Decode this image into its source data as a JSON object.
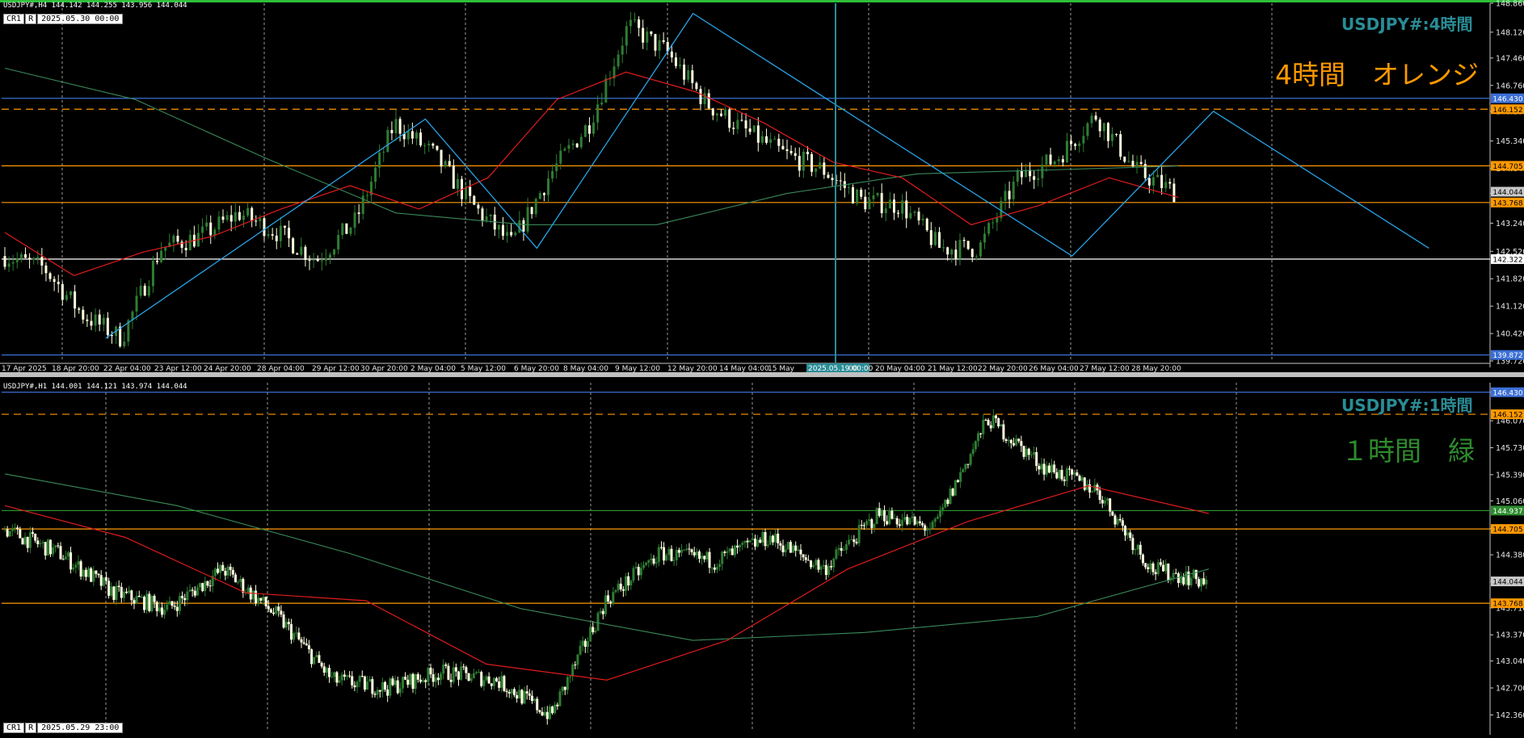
{
  "colors": {
    "orange": "#ff9900",
    "green": "#2e8b2e",
    "teal": "#2a8c96",
    "bull": "#2e7d32",
    "bear": "#ffffe0",
    "ma_red": "#e01c1c",
    "ma_green": "#3a8a5a",
    "zz_blue": "#29a3e6",
    "zz_yellow": "#f2c200",
    "blue_line": "#3b6fd6"
  },
  "panes": [
    {
      "header": "USDJPY#,H4  144.142 144.255 143.956 144.044",
      "cr": "CR1",
      "r": "R",
      "date_box": "2025.05.30 00:00",
      "title": "USDJPY#:4時間",
      "note": "4時間　オレンジ",
      "price_ticks": [
        "148.860",
        "148.120",
        "147.460",
        "146.760",
        "146.100",
        "145.340",
        "144.640",
        "144.000",
        "143.240",
        "142.520",
        "141.820",
        "141.120",
        "140.420",
        "139.720"
      ],
      "time_labels": [
        "17 Apr 2025",
        "18 Apr 20:00",
        "22 Apr 04:00",
        "23 Apr 12:00",
        "24 Apr 20:00",
        "28 Apr 04:00",
        "29 Apr 12:00",
        "30 Apr 20:00",
        "2 May 04:00",
        "5 May 12:00",
        "6 May 20:00",
        "8 May 04:00",
        "9 May 12:00",
        "12 May 20:00",
        "14 May 04:00",
        "15 May",
        "2025.05.19 00:00",
        "00",
        "20 May 04:00",
        "21 May 12:00",
        "22 May 20:00",
        "26 May 04:00",
        "27 May 12:00",
        "28 May 20:00"
      ],
      "levels": [
        {
          "price": 146.43,
          "label": "146.430",
          "style": "solid",
          "color": "#3b6fd6",
          "tag": "#3b6fd6"
        },
        {
          "price": 146.152,
          "label": "146.152",
          "style": "dashed",
          "color": "#ff9900",
          "tag": "#ff9900"
        },
        {
          "price": 144.705,
          "label": "144.705",
          "style": "solid",
          "color": "#ff9900",
          "tag": "#ff9900"
        },
        {
          "price": 143.768,
          "label": "143.768",
          "style": "solid",
          "color": "#ff9900",
          "tag": "#ff9900"
        },
        {
          "price": 142.322,
          "label": "142.322",
          "style": "solid",
          "color": "#ffffff",
          "tag": "#ffffff"
        },
        {
          "price": 139.872,
          "label": "139.872",
          "style": "solid",
          "color": "#3b6fd6",
          "tag": "#3b6fd6"
        }
      ],
      "current_price": "144.044"
    },
    {
      "header": "USDJPY#,H1  144.001 144.121 143.974 144.044",
      "cr": "CR1",
      "r": "R",
      "date_box": "2025.05.29 23:00",
      "title": "USDJPY#:1時間",
      "note": "１時間　緑",
      "price_ticks": [
        "146.430",
        "146.070",
        "145.730",
        "145.390",
        "145.060",
        "144.710",
        "144.380",
        "144.044",
        "143.710",
        "143.370",
        "143.040",
        "142.700",
        "142.360"
      ],
      "levels": [
        {
          "price": 146.43,
          "label": "146.430",
          "style": "solid",
          "color": "#3b6fd6",
          "tag": "#3b6fd6"
        },
        {
          "price": 146.152,
          "label": "146.152",
          "style": "dashed",
          "color": "#ff9900",
          "tag": "#ff9900"
        },
        {
          "price": 144.937,
          "label": "144.937",
          "style": "solid",
          "color": "#2e8b2e",
          "tag": "#2e8b2e"
        },
        {
          "price": 144.705,
          "label": "144.705",
          "style": "solid",
          "color": "#ff9900",
          "tag": "#ff9900"
        },
        {
          "price": 143.768,
          "label": "143.768",
          "style": "solid",
          "color": "#ff9900",
          "tag": "#ff9900"
        }
      ],
      "current_price": "144.044"
    }
  ],
  "chart_data": [
    {
      "type": "candlestick",
      "timeframe": "H4",
      "ylim": [
        139.72,
        148.86
      ],
      "x_range": [
        "17 Apr 2025",
        "3 Jun 2025"
      ],
      "close_path": [
        [
          "17 Apr 2025",
          142.4
        ],
        [
          "18 Apr 20:00",
          142.1
        ],
        [
          "21 Apr",
          140.9
        ],
        [
          "22 Apr 04:00",
          140.3
        ],
        [
          "23 Apr 12:00",
          142.6
        ],
        [
          "24 Apr 20:00",
          142.9
        ],
        [
          "25 Apr",
          143.5
        ],
        [
          "28 Apr 04:00",
          143.0
        ],
        [
          "29 Apr 12:00",
          142.3
        ],
        [
          "30 Apr 20:00",
          143.3
        ],
        [
          "1 May",
          145.8
        ],
        [
          "2 May 04:00",
          145.0
        ],
        [
          "5 May 12:00",
          143.7
        ],
        [
          "6 May 20:00",
          142.7
        ],
        [
          "8 May 04:00",
          144.5
        ],
        [
          "9 May 12:00",
          145.8
        ],
        [
          "12 May 04:00",
          148.3
        ],
        [
          "12 May 20:00",
          147.6
        ],
        [
          "14 May 04:00",
          146.3
        ],
        [
          "15 May",
          145.6
        ],
        [
          "19 May 00:00",
          145.0
        ],
        [
          "20 May 04:00",
          144.6
        ],
        [
          "21 May 12:00",
          143.8
        ],
        [
          "22 May 20:00",
          143.7
        ],
        [
          "23 May",
          142.6
        ],
        [
          "26 May 04:00",
          142.6
        ],
        [
          "27 May 12:00",
          144.4
        ],
        [
          "28 May 04:00",
          144.9
        ],
        [
          "28 May 20:00",
          146.0
        ],
        [
          "29 May 12:00",
          144.6
        ],
        [
          "30 May 00:00",
          144.044
        ]
      ],
      "ma_red": [
        [
          "17 Apr 2025",
          143.0
        ],
        [
          "22 Apr 04:00",
          141.9
        ],
        [
          "24 Apr 20:00",
          142.5
        ],
        [
          "29 Apr 12:00",
          142.9
        ],
        [
          "2 May 04:00",
          143.6
        ],
        [
          "5 May 12:00",
          144.2
        ],
        [
          "6 May 20:00",
          143.6
        ],
        [
          "9 May 12:00",
          144.4
        ],
        [
          "12 May 20:00",
          146.4
        ],
        [
          "14 May 04:00",
          147.1
        ],
        [
          "15 May",
          146.6
        ],
        [
          "19 May 00:00",
          145.8
        ],
        [
          "21 May 12:00",
          144.8
        ],
        [
          "22 May 20:00",
          144.4
        ],
        [
          "26 May 04:00",
          143.2
        ],
        [
          "27 May 12:00",
          143.7
        ],
        [
          "28 May 20:00",
          144.4
        ],
        [
          "30 May 00:00",
          143.9
        ]
      ],
      "ma_green": [
        [
          "17 Apr 2025",
          147.2
        ],
        [
          "22 Apr 04:00",
          146.4
        ],
        [
          "28 Apr 04:00",
          144.9
        ],
        [
          "2 May 04:00",
          143.5
        ],
        [
          "6 May 20:00",
          143.2
        ],
        [
          "9 May 12:00",
          143.2
        ],
        [
          "15 May",
          144.0
        ],
        [
          "20 May 04:00",
          144.5
        ],
        [
          "26 May 04:00",
          144.6
        ],
        [
          "28 May 20:00",
          144.7
        ]
      ],
      "zigzag": [
        [
          "22 Apr 04:00",
          140.3
        ],
        [
          "30 Apr 20:00",
          145.9
        ],
        [
          "6 May 20:00",
          142.6
        ],
        [
          "12 May 04:00",
          148.6
        ],
        [
          "26 May 04:00",
          142.4
        ],
        [
          "28 May 20:00",
          146.1
        ],
        [
          "2 Jun 12:00",
          142.6
        ]
      ]
    },
    {
      "type": "candlestick",
      "timeframe": "H1",
      "ylim": [
        142.15,
        146.55
      ],
      "close_path": [
        [
          "pane start",
          144.7
        ],
        [
          "step 40",
          144.4
        ],
        [
          "step 60",
          143.9
        ],
        [
          "step 90",
          143.7
        ],
        [
          "step 120",
          144.2
        ],
        [
          "step 140",
          143.6
        ],
        [
          "step 170",
          142.8
        ],
        [
          "step 200",
          142.7
        ],
        [
          "step 220",
          142.9
        ],
        [
          "step 250",
          142.8
        ],
        [
          "step 265",
          142.35
        ],
        [
          "step 280",
          143.8
        ],
        [
          "step 300",
          144.4
        ],
        [
          "step 320",
          144.3
        ],
        [
          "step 340",
          144.6
        ],
        [
          "step 360",
          144.2
        ],
        [
          "step 380",
          144.9
        ],
        [
          "step 400",
          144.7
        ],
        [
          "step 420",
          146.1
        ],
        [
          "step 435",
          145.5
        ],
        [
          "step 445",
          145.2
        ],
        [
          "step 460",
          144.2
        ],
        [
          "step 475",
          144.044
        ]
      ],
      "ma_red": [
        [
          "pane start",
          145.0
        ],
        [
          "step 60",
          144.6
        ],
        [
          "step 100",
          143.9
        ],
        [
          "step 160",
          143.8
        ],
        [
          "step 220",
          143.0
        ],
        [
          "step 280",
          142.8
        ],
        [
          "step 330",
          143.3
        ],
        [
          "step 380",
          144.2
        ],
        [
          "step 420",
          144.8
        ],
        [
          "step 450",
          145.25
        ],
        [
          "step 475",
          144.9
        ]
      ],
      "ma_green": [
        [
          "pane start",
          145.4
        ],
        [
          "step 80",
          145.0
        ],
        [
          "step 160",
          144.4
        ],
        [
          "step 260",
          143.7
        ],
        [
          "step 320",
          143.3
        ],
        [
          "step 380",
          143.4
        ],
        [
          "step 420",
          143.6
        ],
        [
          "step 475",
          144.2
        ]
      ]
    }
  ]
}
